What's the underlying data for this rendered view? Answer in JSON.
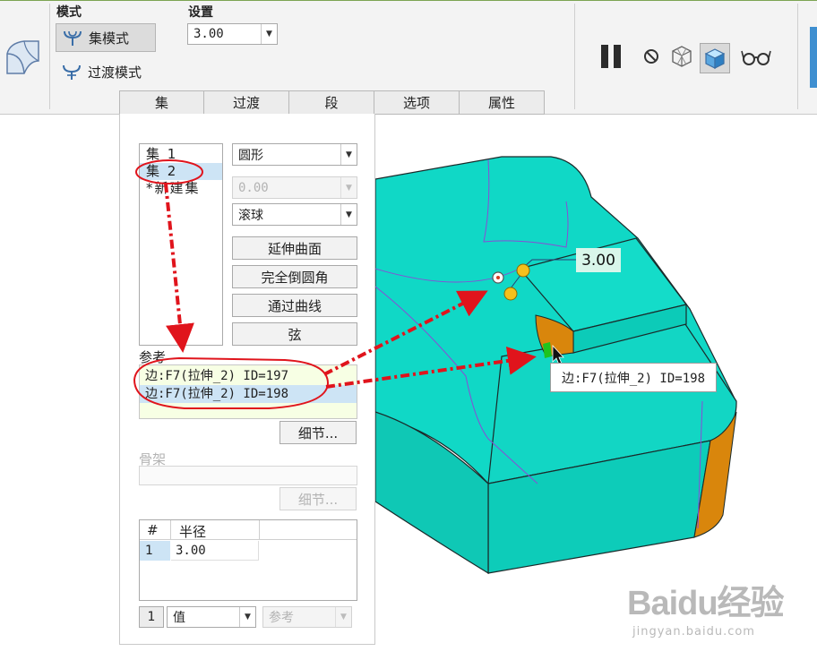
{
  "ribbon": {
    "mode_label": "模式",
    "settings_label": "设置",
    "set_mode": "集模式",
    "transition_mode": "过渡模式",
    "radius_value": "3.00",
    "pause_icon": "pause-icon",
    "no_preview_icon": "no-preview-icon",
    "icons": [
      "pause-icon",
      "no-preview-icon",
      "wireframe-preview-icon",
      "solid-preview-icon",
      "verify-glasses-icon"
    ]
  },
  "tabs": [
    {
      "label": "集",
      "active": true
    },
    {
      "label": "过渡",
      "active": false
    },
    {
      "label": "段",
      "active": false
    },
    {
      "label": "选项",
      "active": false
    },
    {
      "label": "属性",
      "active": false
    }
  ],
  "panel": {
    "sets": [
      {
        "label": "集 1",
        "selected": false
      },
      {
        "label": "集 2",
        "selected": true
      },
      {
        "label": "*新建集",
        "selected": false
      }
    ],
    "cross_section": "圆形",
    "conic_param": "0.00",
    "method": "滚球",
    "buttons": {
      "extend_surfaces": "延伸曲面",
      "full_round": "完全倒圆角",
      "through_curve": "通过曲线",
      "chordal": "弦"
    },
    "references_label": "参考",
    "references": [
      {
        "text": "边:F7(拉伸_2) ID=197",
        "selected": false
      },
      {
        "text": "边:F7(拉伸_2) ID=198",
        "selected": true
      }
    ],
    "details_button": "细节...",
    "skeleton_label": "骨架",
    "skeleton_details_button": "细节...",
    "radius_table": {
      "headers": [
        "#",
        "半径"
      ],
      "rows": [
        {
          "index": "1",
          "radius": "3.00"
        }
      ]
    },
    "footer": {
      "row_number": "1",
      "value_select": "值",
      "reference_select": "参考"
    }
  },
  "viewport": {
    "tooltip": "边:F7(拉伸_2) ID=198",
    "dimension": "3.00",
    "colors": {
      "body": "#10d8c6",
      "edge": "#1a2a2a",
      "round": "#d9860c",
      "annotation": "#e0141c"
    }
  },
  "watermark": {
    "main": "Baidu经验",
    "sub": "jingyan.baidu.com"
  }
}
